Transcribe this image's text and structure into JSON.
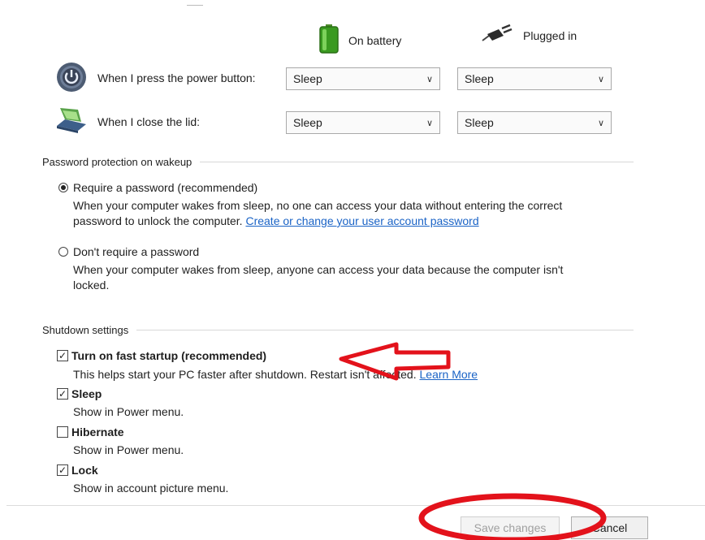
{
  "columns": {
    "battery_label": "On battery",
    "plugged_label": "Plugged in"
  },
  "power_rows": [
    {
      "label": "When I press the power button:",
      "battery_value": "Sleep",
      "plugged_value": "Sleep"
    },
    {
      "label": "When I close the lid:",
      "battery_value": "Sleep",
      "plugged_value": "Sleep"
    }
  ],
  "password_section": {
    "title": "Password protection on wakeup",
    "require": {
      "label": "Require a password (recommended)",
      "selected": true,
      "desc_line1": "When your computer wakes from sleep, no one can access your data without entering the correct",
      "desc_line2": "password to unlock the computer.",
      "link": "Create or change your user account password"
    },
    "no_require": {
      "label": "Don't require a password",
      "selected": false,
      "desc_line1": "When your computer wakes from sleep, anyone can access your data because the computer isn't",
      "desc_line2": "locked."
    }
  },
  "shutdown_section": {
    "title": "Shutdown settings",
    "fast_startup": {
      "label": "Turn on fast startup (recommended)",
      "checked": true,
      "desc": "This helps start your PC faster after shutdown. Restart isn't affected.",
      "link": "Learn More"
    },
    "sleep": {
      "label": "Sleep",
      "checked": true,
      "desc": "Show in Power menu."
    },
    "hibernate": {
      "label": "Hibernate",
      "checked": false,
      "desc": "Show in Power menu."
    },
    "lock": {
      "label": "Lock",
      "checked": true,
      "desc": "Show in account picture menu."
    }
  },
  "footer": {
    "save_label": "Save changes",
    "save_enabled": false,
    "cancel_label": "Cancel"
  },
  "annotation_color": "#e3121b",
  "icons": {
    "battery": "battery-icon",
    "plug": "plug-icon",
    "power": "power-button-icon",
    "lid": "laptop-lid-icon"
  }
}
